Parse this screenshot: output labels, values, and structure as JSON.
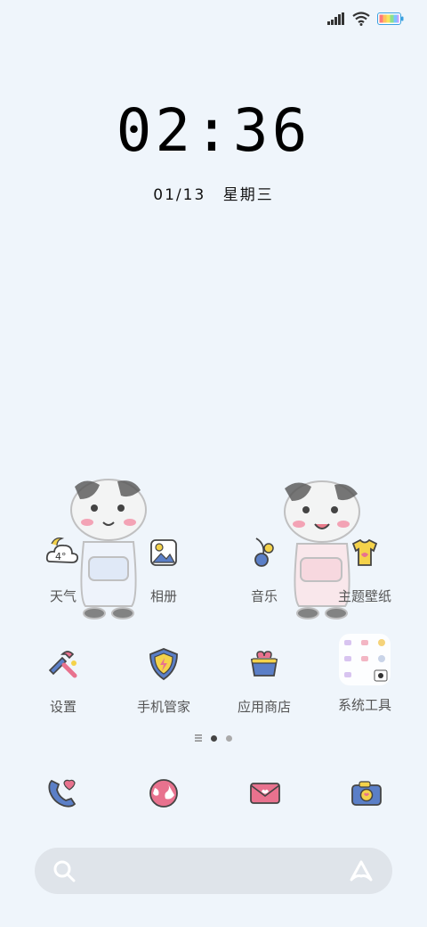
{
  "status": {
    "signal_icon": "signal-icon",
    "wifi_icon": "wifi-icon",
    "battery_icon": "battery-icon"
  },
  "clock": {
    "time": "02:36"
  },
  "date": {
    "text": "01/13",
    "weekday": "星期三"
  },
  "apps": [
    {
      "label": "天气",
      "icon": "weather-icon",
      "temp": "4°"
    },
    {
      "label": "相册",
      "icon": "gallery-icon"
    },
    {
      "label": "音乐",
      "icon": "music-icon"
    },
    {
      "label": "主题壁纸",
      "icon": "theme-icon"
    },
    {
      "label": "设置",
      "icon": "settings-icon"
    },
    {
      "label": "手机管家",
      "icon": "security-icon"
    },
    {
      "label": "应用商店",
      "icon": "app-store-icon"
    },
    {
      "label": "系统工具",
      "icon": "system-tools-folder-icon"
    }
  ],
  "page_indicator": {
    "pages": 3,
    "current": 2
  },
  "dock": [
    "phone-icon",
    "browser-icon",
    "messages-icon",
    "camera-icon"
  ],
  "search": {
    "left_icon": "search-icon",
    "right_icon": "assistant-icon"
  },
  "colors": {
    "background": "#eff5fb",
    "accent_pink": "#e8728e",
    "accent_blue": "#5b7fc7",
    "accent_yellow": "#f4d24a"
  }
}
